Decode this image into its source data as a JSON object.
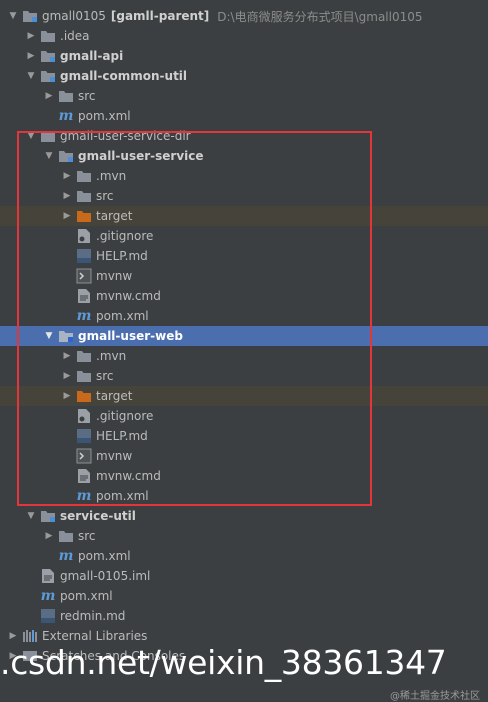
{
  "tree": {
    "root": {
      "label": "gmall0105",
      "module": "[gamll-parent]",
      "path": "D:\\电商微服务分布式项目\\gmall0105"
    },
    "idea": ".idea",
    "gmall_api": "gmall-api",
    "common_util": {
      "label": "gmall-common-util",
      "src": "src",
      "pom": "pom.xml"
    },
    "user_service_dir": "gmall-user-service-dir",
    "user_service": {
      "label": "gmall-user-service",
      "mvn": ".mvn",
      "src": "src",
      "target": "target",
      "gitignore": ".gitignore",
      "help": "HELP.md",
      "mvnw": "mvnw",
      "mvnw_cmd": "mvnw.cmd",
      "pom": "pom.xml"
    },
    "user_web": {
      "label": "gmall-user-web",
      "mvn": ".mvn",
      "src": "src",
      "target": "target",
      "gitignore": ".gitignore",
      "help": "HELP.md",
      "mvnw": "mvnw",
      "mvnw_cmd": "mvnw.cmd",
      "pom": "pom.xml"
    },
    "service_util": {
      "label": "service-util",
      "src": "src",
      "pom": "pom.xml"
    },
    "iml": "gmall-0105.iml",
    "pom": "pom.xml",
    "redmin": "redmin.md",
    "external_libraries": "External Libraries",
    "scratches": "Scratches and Consoles"
  },
  "watermark": {
    "main": ".csdn.net/weixin_38361347",
    "small": "@稀土掘金技术社区"
  },
  "colors": {
    "background": "#3c3f41",
    "selection": "#4b6eaf",
    "excluded_row": "#46443a",
    "highlight_box": "#e3353a",
    "folder": "#8a9099",
    "target_folder": "#c8691c"
  }
}
